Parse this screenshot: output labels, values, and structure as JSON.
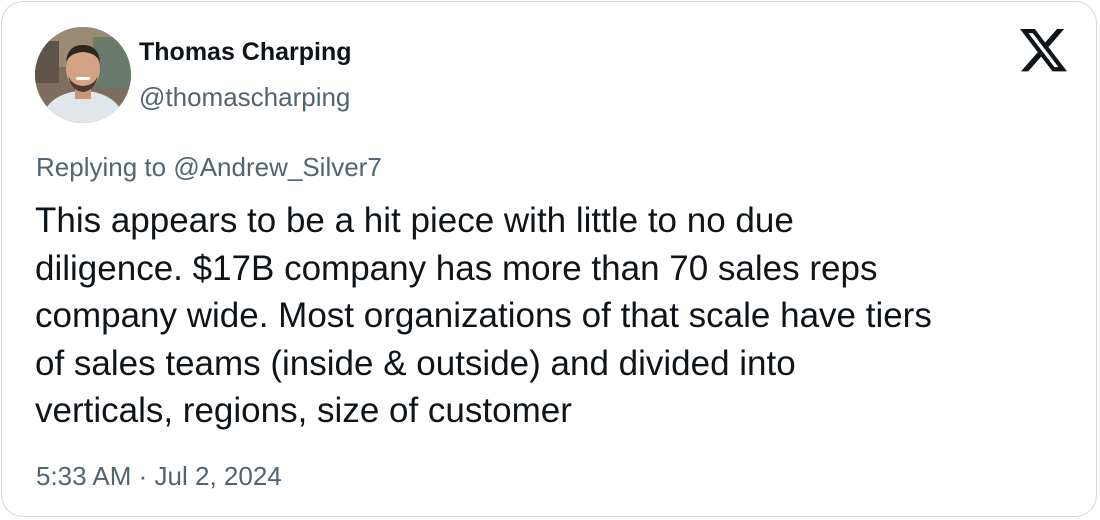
{
  "tweet": {
    "author": {
      "display_name": "Thomas Charping",
      "handle": "@thomascharping",
      "avatar_icon": "profile-photo"
    },
    "platform_icon": "x-logo-icon",
    "reply": {
      "prefix": "Replying to",
      "mention": "@Andrew_Silver7"
    },
    "text_lines": [
      "This appears to be a hit piece with little to no due",
      "diligence. $17B company has more than 70 sales reps",
      "company wide. Most organizations of that scale have tiers",
      "of sales teams (inside & outside) and divided into",
      "verticals, regions, size of customer"
    ],
    "time": "5:33 AM",
    "separator": "·",
    "date": "Jul 2, 2024"
  },
  "colors": {
    "text": "#0f1419",
    "secondary": "#536471",
    "border": "#cfd9de",
    "background": "#ffffff"
  }
}
